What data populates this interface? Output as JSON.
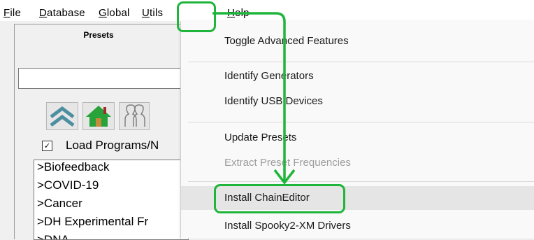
{
  "menubar": {
    "items": [
      {
        "label": "File",
        "first": "F",
        "rest": "ile"
      },
      {
        "label": "Database",
        "first": "D",
        "rest": "atabase"
      },
      {
        "label": "Global",
        "first": "G",
        "rest": "lobal"
      },
      {
        "label": "Utils",
        "first": "U",
        "rest": "tils"
      },
      {
        "label": "Help",
        "first": "H",
        "rest": "elp"
      }
    ]
  },
  "presets": {
    "title": "Presets",
    "search_value": "",
    "load_programs_label": "Load Programs/N",
    "load_programs_checked": true,
    "list": [
      ">Biofeedback",
      ">COVID-19",
      ">Cancer",
      ">DH Experimental Fr",
      ">DNA"
    ]
  },
  "utils_menu": {
    "items": [
      {
        "label": "Toggle Advanced Features",
        "enabled": true
      },
      {
        "label": "Identify Generators",
        "enabled": true
      },
      {
        "label": "Identify USB Devices",
        "enabled": true
      },
      {
        "label": "Update Presets",
        "enabled": true
      },
      {
        "label": "Extract Preset Frequencies",
        "enabled": false
      },
      {
        "label": "Install ChainEditor",
        "enabled": true,
        "hovered": true
      },
      {
        "label": "Install Spooky2-XM Drivers",
        "enabled": true
      }
    ]
  },
  "colors": {
    "annotation": "#1fb53a",
    "home_icon": "#27a33a",
    "up_icon": "#4d8fa0"
  }
}
